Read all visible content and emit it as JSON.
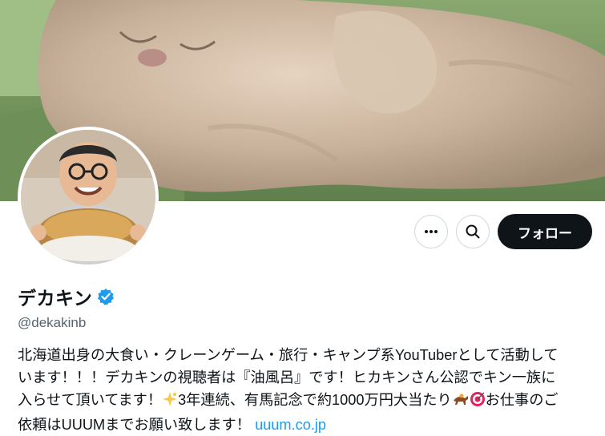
{
  "profile": {
    "name": "デカキン",
    "handle": "@dekakinb",
    "verified": true,
    "bio_lines": [
      "北海道出身の大食い・クレーンゲーム・旅行・キャンプ系YouTuberとして活動して",
      "います！！！デカキンの視聴者は『油風呂』です！ヒカキンさん公認でキン一族に",
      "入らせて頂いてます！",
      "3年連続、有馬記念で約1000万円大当たり",
      "お仕事のご",
      "依頼はUUUMまでお願い致します！",
      "uuum.co.jp"
    ]
  },
  "actions": {
    "more_icon": "more-icon",
    "search_icon": "search-icon",
    "follow_label": "フォロー"
  },
  "colors": {
    "accent_link": "#1d9bf0",
    "verified": "#1d9bf0",
    "follow_bg": "#0f1419",
    "secondary_text": "#536471"
  }
}
